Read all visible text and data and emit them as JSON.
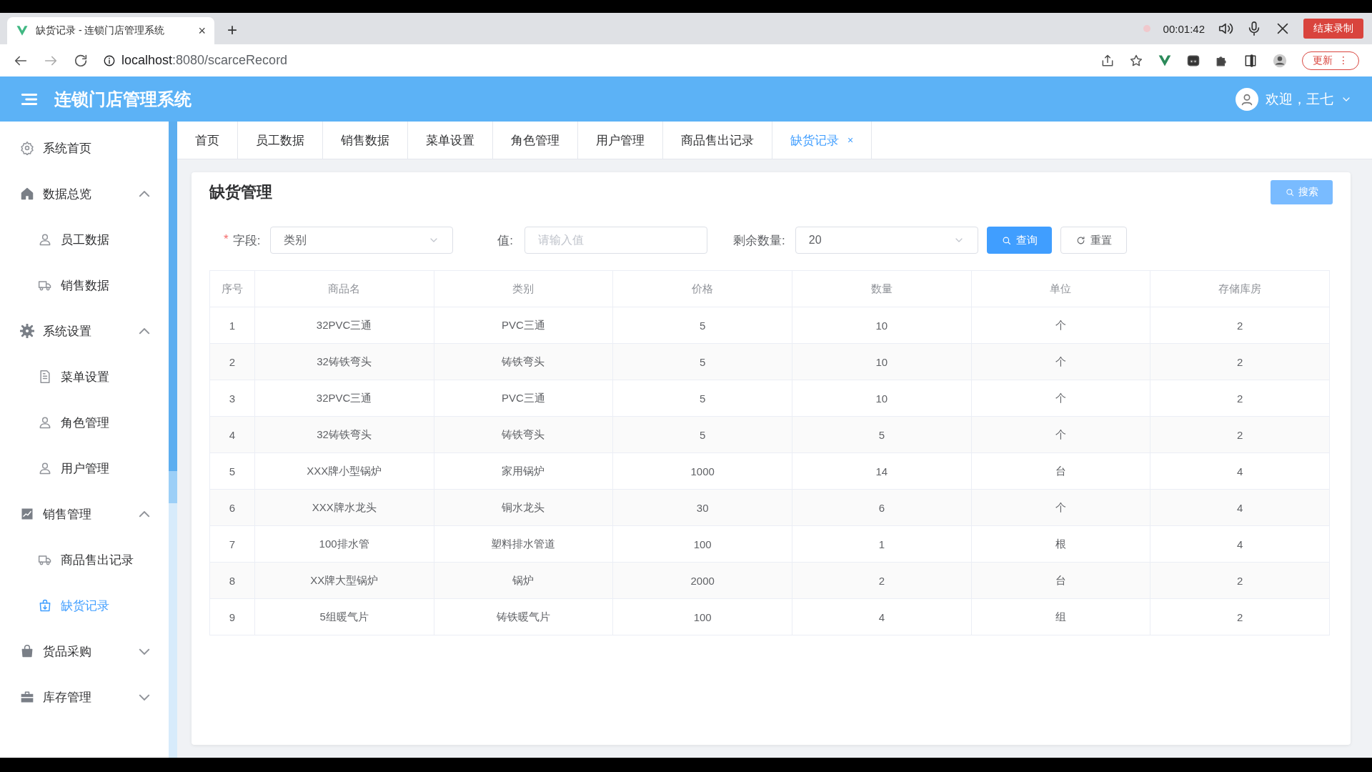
{
  "browser": {
    "tab_title": "缺货记录 - 连锁门店管理系统",
    "new_tab": "+",
    "recording_time": "00:01:42",
    "stop_recording": "结束录制",
    "url_host": "localhost",
    "url_path": ":8080/scarceRecord",
    "update": "更新",
    "menu": "⋮",
    "tab_close": "×"
  },
  "header": {
    "app_title": "连锁门店管理系统",
    "welcome": "欢迎，王七"
  },
  "sidebar": {
    "items": [
      {
        "kind": "item",
        "label": "系统首页",
        "selected": false
      },
      {
        "kind": "group",
        "label": "数据总览",
        "expanded": true
      },
      {
        "kind": "item",
        "label": "员工数据",
        "selected": false
      },
      {
        "kind": "item",
        "label": "销售数据",
        "selected": false
      },
      {
        "kind": "group",
        "label": "系统设置",
        "expanded": true
      },
      {
        "kind": "item",
        "label": "菜单设置",
        "selected": false
      },
      {
        "kind": "item",
        "label": "角色管理",
        "selected": false
      },
      {
        "kind": "item",
        "label": "用户管理",
        "selected": false
      },
      {
        "kind": "group",
        "label": "销售管理",
        "expanded": true
      },
      {
        "kind": "item",
        "label": "商品售出记录",
        "selected": false
      },
      {
        "kind": "item",
        "label": "缺货记录",
        "selected": true
      },
      {
        "kind": "group",
        "label": "货品采购",
        "expanded": false
      },
      {
        "kind": "group",
        "label": "库存管理",
        "expanded": false
      }
    ]
  },
  "tabs": [
    {
      "label": "首页",
      "selected": false
    },
    {
      "label": "员工数据",
      "selected": false
    },
    {
      "label": "销售数据",
      "selected": false
    },
    {
      "label": "菜单设置",
      "selected": false
    },
    {
      "label": "角色管理",
      "selected": false
    },
    {
      "label": "用户管理",
      "selected": false
    },
    {
      "label": "商品售出记录",
      "selected": false
    },
    {
      "label": "缺货记录",
      "selected": true,
      "close": "×"
    }
  ],
  "card": {
    "title": "缺货管理",
    "search_button": "搜索"
  },
  "filters": {
    "required_mark": "*",
    "field_label": "字段:",
    "field_value": "类别",
    "value_label": "值:",
    "value_placeholder": "请输入值",
    "remain_label": "剩余数量:",
    "remain_value": "20",
    "query_button": "查询",
    "reset_button": "重置"
  },
  "table": {
    "columns": [
      "序号",
      "商品名",
      "类别",
      "价格",
      "数量",
      "单位",
      "存储库房"
    ],
    "rows": [
      [
        "1",
        "32PVC三通",
        "PVC三通",
        "5",
        "10",
        "个",
        "2"
      ],
      [
        "2",
        "32铸铁弯头",
        "铸铁弯头",
        "5",
        "10",
        "个",
        "2"
      ],
      [
        "3",
        "32PVC三通",
        "PVC三通",
        "5",
        "10",
        "个",
        "2"
      ],
      [
        "4",
        "32铸铁弯头",
        "铸铁弯头",
        "5",
        "5",
        "个",
        "2"
      ],
      [
        "5",
        "XXX牌小型锅炉",
        "家用锅炉",
        "1000",
        "14",
        "台",
        "4"
      ],
      [
        "6",
        "XXX牌水龙头",
        "铜水龙头",
        "30",
        "6",
        "个",
        "4"
      ],
      [
        "7",
        "100排水管",
        "塑料排水管道",
        "100",
        "1",
        "根",
        "4"
      ],
      [
        "8",
        "XX牌大型锅炉",
        "锅炉",
        "2000",
        "2",
        "台",
        "2"
      ],
      [
        "9",
        "5组暖气片",
        "铸铁暖气片",
        "100",
        "4",
        "组",
        "2"
      ]
    ]
  }
}
